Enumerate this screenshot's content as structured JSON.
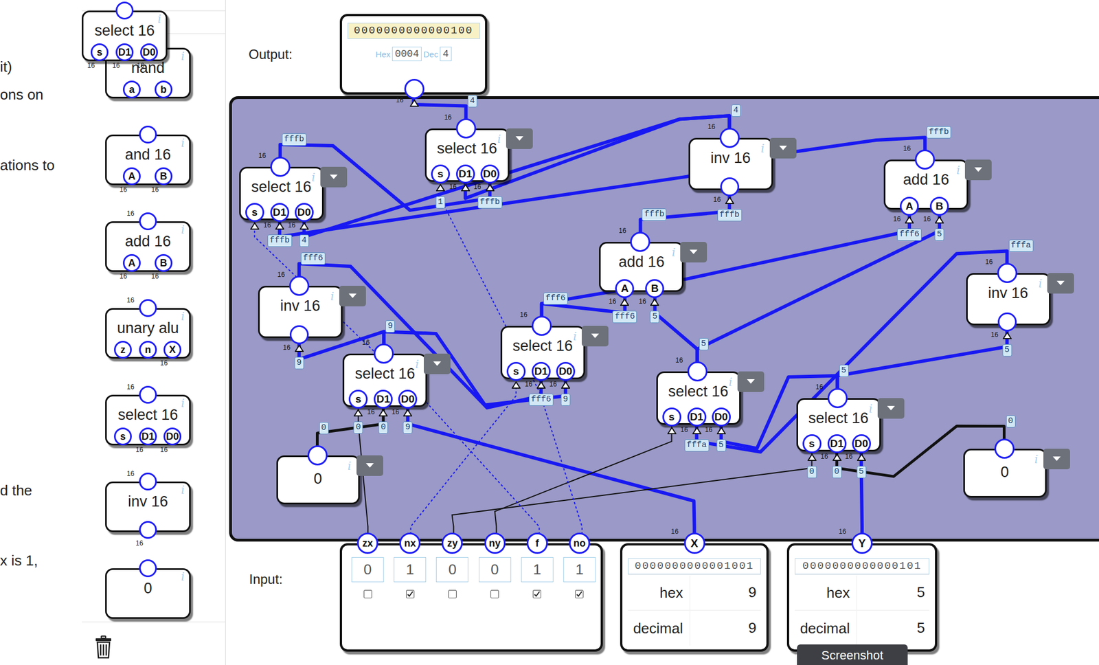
{
  "left_text": [
    "it)",
    "ons on",
    "ations to",
    "d the",
    "x is 1,"
  ],
  "info_mark": "i",
  "palette": {
    "dragged": {
      "label": "select 16",
      "out_bits": "",
      "pins": [
        {
          "name": "s",
          "bits": "16"
        },
        {
          "name": "D1",
          "bits": "16"
        },
        {
          "name": "D0",
          "bits": "16"
        }
      ]
    },
    "items": [
      {
        "label": "nand",
        "out_bits": "",
        "pins": [
          {
            "name": "a",
            "bits": ""
          },
          {
            "name": "b",
            "bits": ""
          }
        ]
      },
      {
        "label": "and 16",
        "out_bits": "",
        "pins": [
          {
            "name": "A",
            "bits": "16"
          },
          {
            "name": "B",
            "bits": "16"
          }
        ]
      },
      {
        "label": "add 16",
        "out_bits": "16",
        "pins": [
          {
            "name": "A",
            "bits": "16"
          },
          {
            "name": "B",
            "bits": "16"
          }
        ]
      },
      {
        "label": "unary alu",
        "out_bits": "16",
        "pins": [
          {
            "name": "z",
            "bits": ""
          },
          {
            "name": "n",
            "bits": ""
          },
          {
            "name": "X",
            "bits": "16"
          }
        ]
      },
      {
        "label": "select 16",
        "out_bits": "16",
        "pins": [
          {
            "name": "s",
            "bits": ""
          },
          {
            "name": "D1",
            "bits": "16"
          },
          {
            "name": "D0",
            "bits": "16"
          }
        ]
      },
      {
        "label": "inv 16",
        "out_bits": "16",
        "pins": [
          {
            "name": "",
            "bits": "16"
          }
        ]
      },
      {
        "label": "0",
        "out_bits": "",
        "pins": []
      }
    ]
  },
  "output": {
    "label": "Output:",
    "binary": "0000000000000100",
    "hex_label": "Hex",
    "hex": "0004",
    "dec_label": "Dec",
    "dec": "4",
    "bits": "16"
  },
  "nodes": [
    {
      "id": "n1",
      "kind": "select",
      "label": "select 16",
      "bits": "16",
      "output": "fffb",
      "pins": [
        {
          "name": "s",
          "value": "",
          "bus": false
        },
        {
          "name": "D1",
          "value": "fffb",
          "bus": true
        },
        {
          "name": "D0",
          "value": "4",
          "bus": true
        }
      ]
    },
    {
      "id": "n2",
      "kind": "select",
      "label": "select 16",
      "bits": "16",
      "output": "4",
      "pins": [
        {
          "name": "s",
          "value": "1",
          "bus": false
        },
        {
          "name": "D1",
          "value": "",
          "bus": true
        },
        {
          "name": "D0",
          "value": "fffb",
          "bus": true
        }
      ]
    },
    {
      "id": "n3",
      "kind": "inv",
      "label": "inv 16",
      "bits": "16",
      "output": "4",
      "pins": [
        {
          "name": "",
          "value": "fffb",
          "bus": true
        }
      ]
    },
    {
      "id": "n4",
      "kind": "add",
      "label": "add 16",
      "bits": "16",
      "output": "fffb",
      "pins": [
        {
          "name": "A",
          "value": "fff6",
          "bus": true
        },
        {
          "name": "B",
          "value": "5",
          "bus": true
        }
      ]
    },
    {
      "id": "n5",
      "kind": "inv",
      "label": "inv 16",
      "bits": "16",
      "output": "fff6",
      "pins": [
        {
          "name": "",
          "value": "9",
          "bus": true
        }
      ]
    },
    {
      "id": "n6",
      "kind": "select",
      "label": "select 16",
      "bits": "16",
      "output": "9",
      "pins": [
        {
          "name": "s",
          "value": "0",
          "bus": false
        },
        {
          "name": "D1",
          "value": "0",
          "bus": true
        },
        {
          "name": "D0",
          "value": "9",
          "bus": true
        }
      ]
    },
    {
      "id": "n7",
      "kind": "const",
      "label": "0",
      "bits": "",
      "output": "0",
      "pins": []
    },
    {
      "id": "n8",
      "kind": "select",
      "label": "select 16",
      "bits": "16",
      "output": "fff6",
      "pins": [
        {
          "name": "s",
          "value": "",
          "bus": false
        },
        {
          "name": "D1",
          "value": "fff6",
          "bus": true
        },
        {
          "name": "D0",
          "value": "9",
          "bus": true
        }
      ]
    },
    {
      "id": "n9",
      "kind": "add",
      "label": "add 16",
      "bits": "16",
      "output": "fffb",
      "pins": [
        {
          "name": "A",
          "value": "fff6",
          "bus": true
        },
        {
          "name": "B",
          "value": "5",
          "bus": true
        }
      ]
    },
    {
      "id": "n10",
      "kind": "select",
      "label": "select 16",
      "bits": "16",
      "output": "5",
      "pins": [
        {
          "name": "s",
          "value": "",
          "bus": false
        },
        {
          "name": "D1",
          "value": "fffa",
          "bus": true
        },
        {
          "name": "D0",
          "value": "5",
          "bus": true
        }
      ]
    },
    {
      "id": "n11",
      "kind": "select",
      "label": "select 16",
      "bits": "16",
      "output": "5",
      "pins": [
        {
          "name": "s",
          "value": "0",
          "bus": false
        },
        {
          "name": "D1",
          "value": "0",
          "bus": true
        },
        {
          "name": "D0",
          "value": "5",
          "bus": true
        }
      ]
    },
    {
      "id": "n12",
      "kind": "inv",
      "label": "inv 16",
      "bits": "16",
      "output": "fffa",
      "pins": [
        {
          "name": "",
          "value": "5",
          "bus": true
        }
      ]
    },
    {
      "id": "n13",
      "kind": "const",
      "label": "0",
      "bits": "",
      "output": "0",
      "pins": []
    }
  ],
  "wires": [
    {
      "from": "n2.out",
      "to": "out",
      "kind": "bus"
    },
    {
      "from": "n7.out",
      "to": "n6.D1",
      "kind": "bus-zero"
    },
    {
      "from": "zx",
      "to": "n6.s",
      "kind": "low"
    },
    {
      "from": "X",
      "to": "n6.D0",
      "kind": "bus"
    },
    {
      "from": "n6.out",
      "to": "n5.in",
      "kind": "bus"
    },
    {
      "from": "n6.out",
      "to": "n8.D0",
      "kind": "bus"
    },
    {
      "from": "n5.out",
      "to": "n8.D1",
      "kind": "bus"
    },
    {
      "from": "nx",
      "to": "n8.s",
      "kind": "high"
    },
    {
      "from": "n8.out",
      "to": "n9.A",
      "kind": "bus"
    },
    {
      "from": "n8.out",
      "to": "n4.A",
      "kind": "bus"
    },
    {
      "from": "n10.out",
      "to": "n9.B",
      "kind": "bus"
    },
    {
      "from": "n10.out",
      "to": "n4.B",
      "kind": "bus"
    },
    {
      "from": "n11.out",
      "to": "n10.D0",
      "kind": "bus"
    },
    {
      "from": "n11.out",
      "to": "n12.in",
      "kind": "bus"
    },
    {
      "from": "n12.out",
      "to": "n10.D1",
      "kind": "bus"
    },
    {
      "from": "n13.out",
      "to": "n11.D1",
      "kind": "bus-zero"
    },
    {
      "from": "Y",
      "to": "n11.D0",
      "kind": "bus"
    },
    {
      "from": "zy",
      "to": "n11.s",
      "kind": "low"
    },
    {
      "from": "ny",
      "to": "n10.s",
      "kind": "low"
    },
    {
      "from": "no",
      "to": "n2.s",
      "kind": "high"
    },
    {
      "from": "f",
      "to": "n1.s",
      "kind": "high"
    },
    {
      "from": "n9.out",
      "to": "n3.in",
      "kind": "bus"
    },
    {
      "from": "n4.out",
      "to": "n1.D1",
      "kind": "bus"
    },
    {
      "from": "n3.out",
      "to": "n1.D0",
      "kind": "bus"
    },
    {
      "from": "n3.out",
      "to": "n2.D1",
      "kind": "bus"
    },
    {
      "from": "n1.out",
      "to": "n2.D0",
      "kind": "bus"
    }
  ],
  "input": {
    "label": "Input:",
    "pins": [
      {
        "name": "zx",
        "value": "0",
        "checked": false
      },
      {
        "name": "nx",
        "value": "1",
        "checked": true
      },
      {
        "name": "zy",
        "value": "0",
        "checked": false
      },
      {
        "name": "ny",
        "value": "0",
        "checked": false
      },
      {
        "name": "f",
        "value": "1",
        "checked": true
      },
      {
        "name": "no",
        "value": "1",
        "checked": true
      }
    ]
  },
  "numbers": [
    {
      "name": "X",
      "bits": "16",
      "binary": "0000000000001001",
      "hex_label": "hex",
      "hex": "9",
      "dec_label": "decimal",
      "dec": "9"
    },
    {
      "name": "Y",
      "bits": "16",
      "binary": "0000000000000101",
      "hex_label": "hex",
      "hex": "5",
      "dec_label": "decimal",
      "dec": "5"
    }
  ],
  "screenshot_button": "Screenshot"
}
